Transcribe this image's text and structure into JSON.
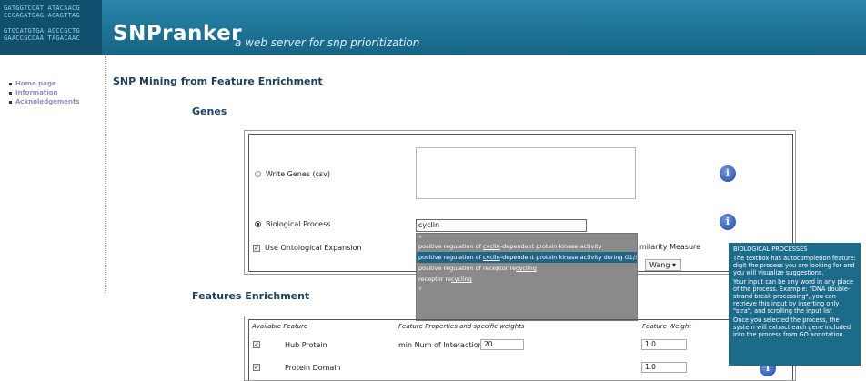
{
  "header": {
    "logo_lines": [
      "GATGGTCCAT ATACAACG",
      "CCGAGATGAG ACAGTTAG",
      "GTGCATGTGA AGCCGCTG",
      "GAACCGCCAA TAGACAAC"
    ],
    "title": "SNPranker",
    "subtitle": "a web server for snp prioritization"
  },
  "sidebar": {
    "items": [
      "Home page",
      "Information",
      "Acknoledgements"
    ]
  },
  "main": {
    "page_heading": "SNP Mining from Feature Enrichment",
    "genes_heading": "Genes",
    "features_heading": "Features Enrichment"
  },
  "genes_form": {
    "write_genes_label": "Write Genes (csv)",
    "biological_process_label": "Biological Process",
    "biological_process_value": "cyclin",
    "ontological_expansion_label": "Use Ontological Expansion",
    "similarity_label": "milarity Measure",
    "similarity_value": "Wang ▾"
  },
  "autocomplete": {
    "items": [
      {
        "before": "positive regulation of ",
        "match": "cyclin",
        "after": "-dependent protein kinase activity"
      },
      {
        "before": "positive regulation of ",
        "match": "cyclin",
        "after": "-dependent protein kinase activity during G1/S"
      },
      {
        "before": "positive regulation of receptor re",
        "match": "cycling",
        "after": ""
      },
      {
        "before": "receptor re",
        "match": "cycling",
        "after": ""
      }
    ]
  },
  "tooltip": {
    "title": "BIOLOGICAL PROCESSES",
    "p1": "The textbox has autocompletion feature: digit the process you are looking for and you will visualize suggestions.",
    "p2": "Your input can be any word in any place of the process. Example: \"DNA double-strand break processing\", you can retrieve this input by inserting only \"stra\", and scrolling the input list",
    "p3": "Once you selected the process, the system will extract each gene included into the process from GO annotation."
  },
  "features_table": {
    "headers": [
      "Available Feature",
      "Feature Properties and specific weights",
      "Feature Weight"
    ],
    "rows": [
      {
        "name": "Hub Protein",
        "property": "min Num of Interactions",
        "property_value": "20",
        "weight": "1.0"
      },
      {
        "name": "Protein Domain",
        "property": "",
        "property_value": "",
        "weight": "1.0"
      }
    ]
  },
  "icons": {
    "info": "i"
  }
}
